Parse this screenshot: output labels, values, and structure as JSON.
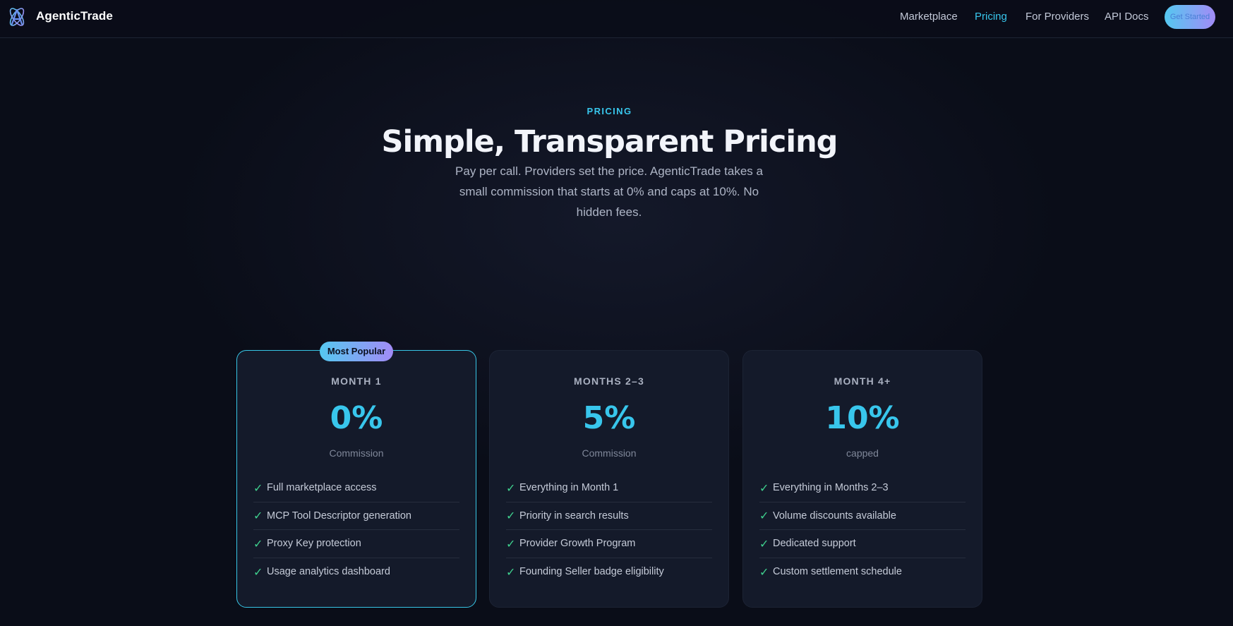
{
  "nav": {
    "brand": "AgenticTrade",
    "links": [
      {
        "label": "Marketplace",
        "active": false
      },
      {
        "label": "Pricing",
        "active": true
      },
      {
        "label": "For Providers",
        "active": false
      },
      {
        "label": "API Docs",
        "active": false
      }
    ],
    "cta_label": "Get Started"
  },
  "hero": {
    "eyebrow": "PRICING",
    "title": "Simple, Transparent Pricing",
    "subtitle": "Pay per call. Providers set the price. AgenticTrade takes a small commission that starts at 0% and caps at 10%. No hidden fees."
  },
  "plans": [
    {
      "badge": "Most Popular",
      "tier": "MONTH 1",
      "rate": "0%",
      "rate_label": "Commission",
      "features": [
        "Full marketplace access",
        "MCP Tool Descriptor generation",
        "Proxy Key protection",
        "Usage analytics dashboard"
      ]
    },
    {
      "tier": "MONTHS 2–3",
      "rate": "5%",
      "rate_label": "Commission",
      "features": [
        "Everything in Month 1",
        "Priority in search results",
        "Provider Growth Program",
        "Founding Seller badge eligibility"
      ]
    },
    {
      "tier": "MONTH 4+",
      "rate": "10%",
      "rate_label": "capped",
      "features": [
        "Everything in Months 2–3",
        "Volume discounts available",
        "Dedicated support",
        "Custom settlement schedule"
      ]
    }
  ],
  "colors": {
    "accent": "#38c6ec",
    "check": "#3fd08e",
    "gradient_start": "#55c8f0",
    "gradient_end": "#a28bf6",
    "background": "#0a0d18",
    "card": "#141a2a"
  },
  "icons": {
    "logo": "atom-a-logo-icon",
    "check": "check-icon"
  }
}
